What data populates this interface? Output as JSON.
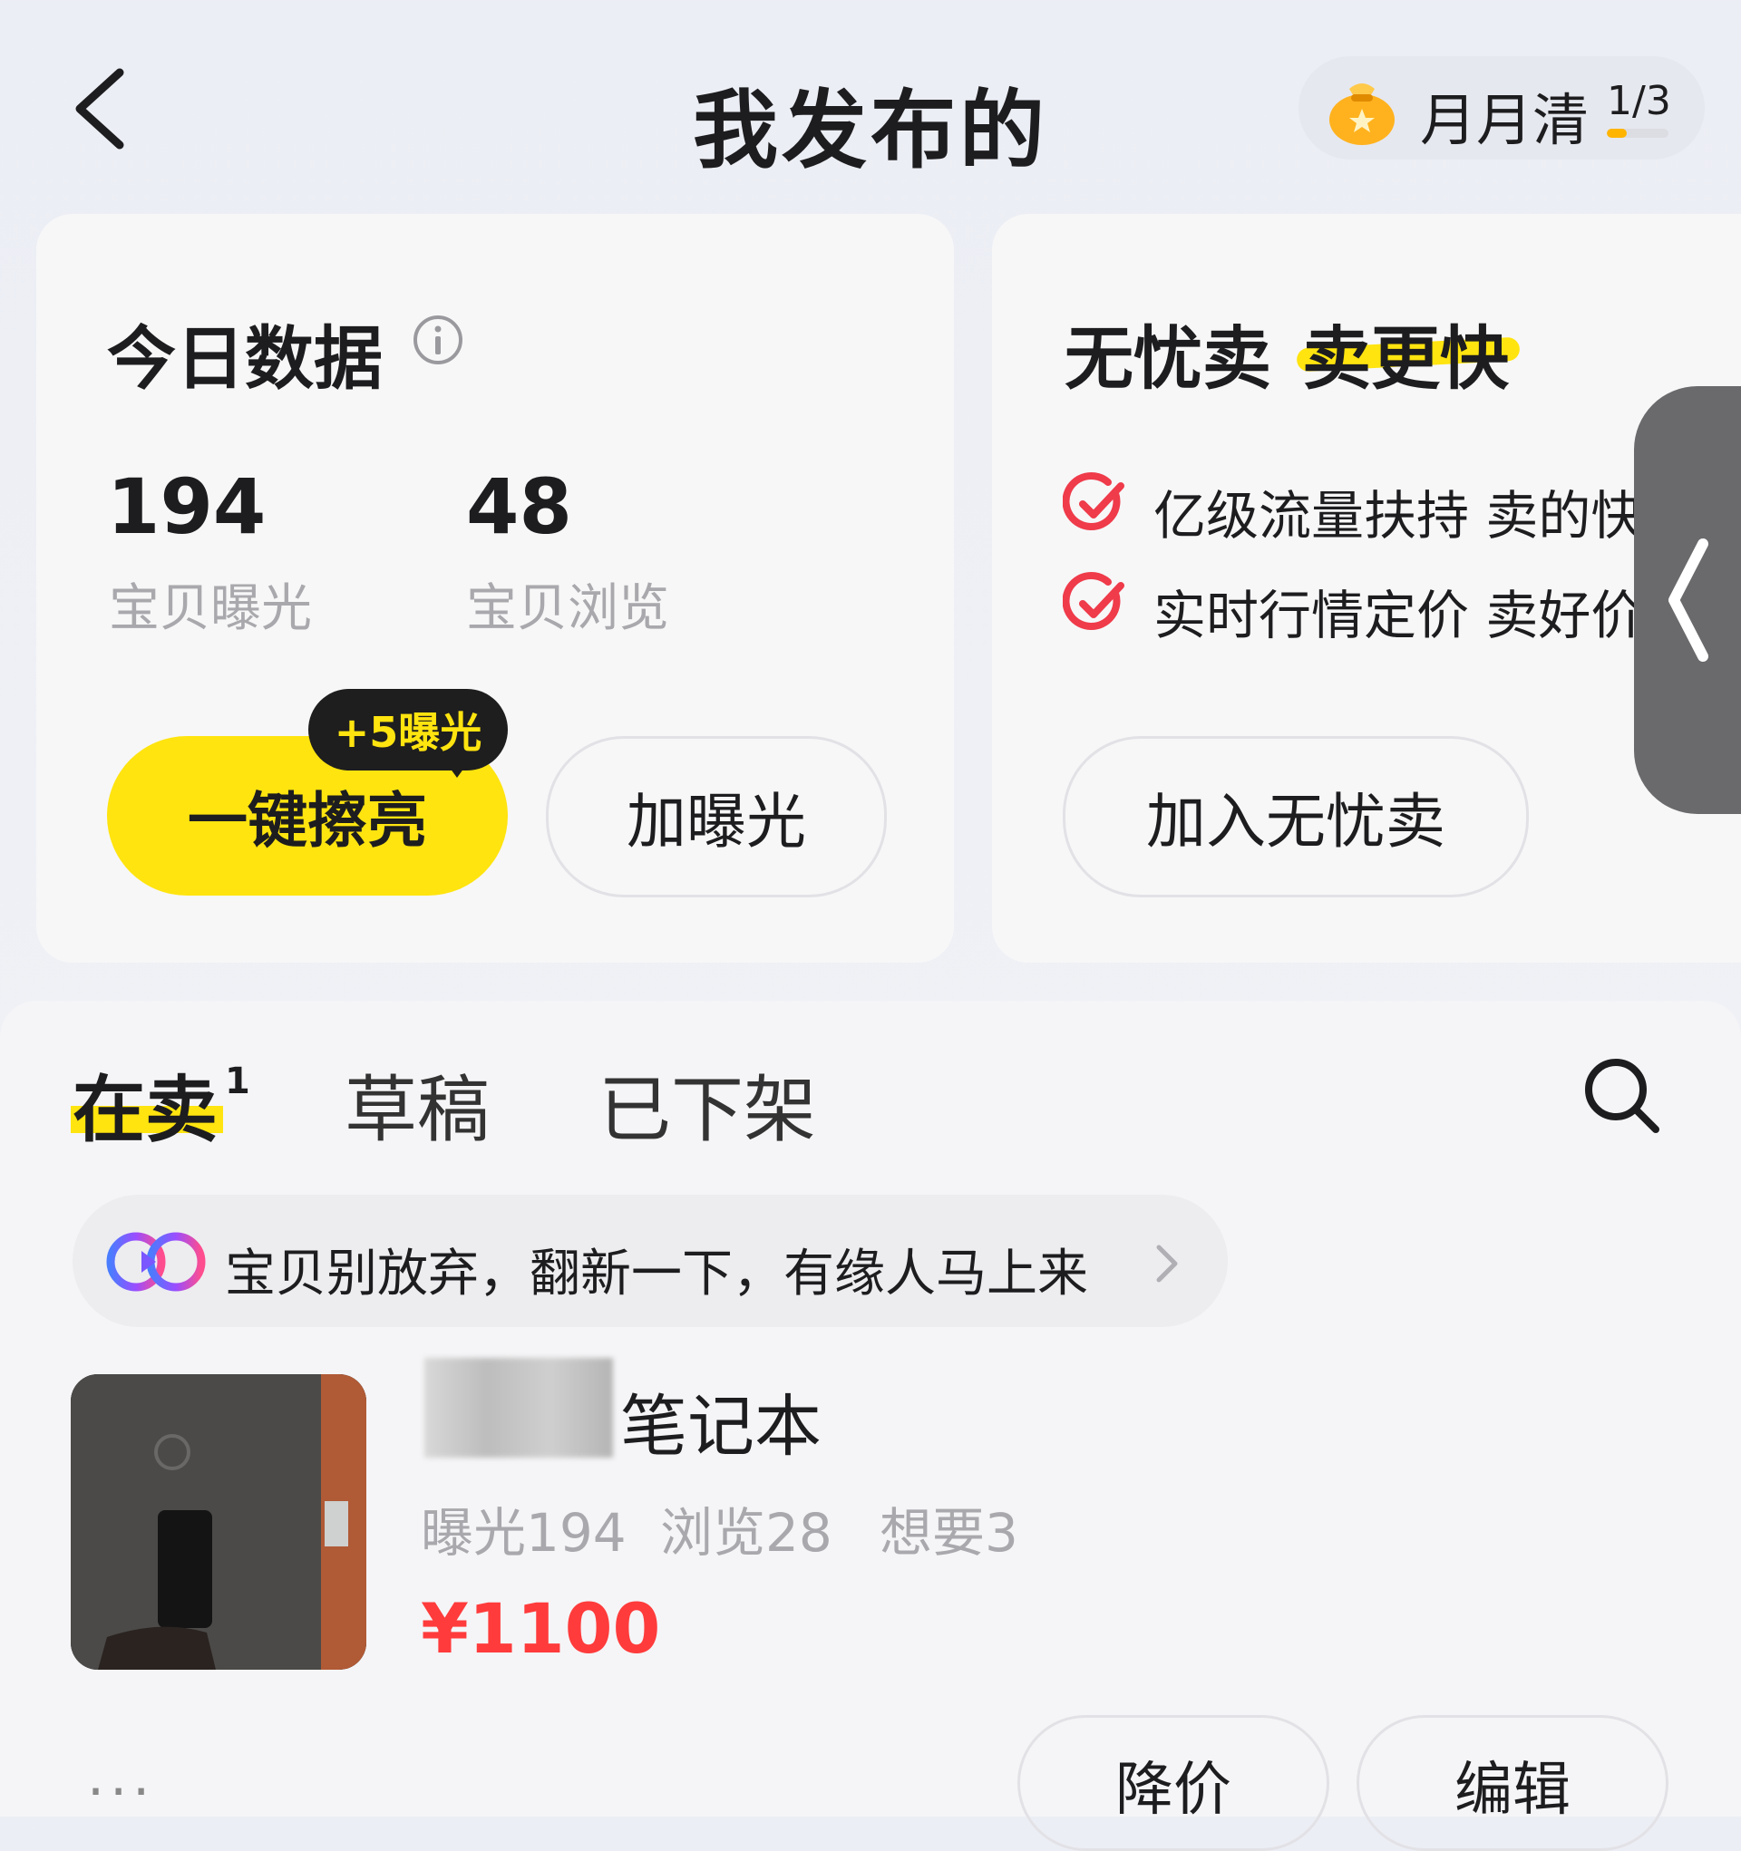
{
  "header": {
    "title": "我发布的",
    "monthly": {
      "label": "月月清",
      "count": "1/3",
      "progress": 0.33
    }
  },
  "today_card": {
    "title": "今日数据",
    "stats": [
      {
        "value": "194",
        "label": "宝贝曝光"
      },
      {
        "value": "48",
        "label": "宝贝浏览"
      }
    ],
    "polish_button": "一键擦亮",
    "polish_badge": "+5曝光",
    "expose_button": "加曝光"
  },
  "worry_card": {
    "title_part1": "无忧卖",
    "title_part2": "卖更快",
    "features": [
      "亿级流量扶持 卖的快",
      "实时行情定价 卖好价"
    ],
    "join_button": "加入无忧卖"
  },
  "tabs": [
    {
      "label": "在卖",
      "badge": "1",
      "active": true
    },
    {
      "label": "草稿"
    },
    {
      "label": "已下架"
    }
  ],
  "notice": {
    "text": "宝贝别放弃，翻新一下，有缘人马上来"
  },
  "item": {
    "title": "笔记本",
    "stats": [
      "曝光194",
      "浏览28",
      "想要3"
    ],
    "price": "¥1100",
    "actions": [
      "降价",
      "编辑"
    ],
    "more": "···"
  },
  "colors": {
    "accent": "#ffe40f",
    "price": "#ff3b3b",
    "check": "#ef3b4a"
  }
}
